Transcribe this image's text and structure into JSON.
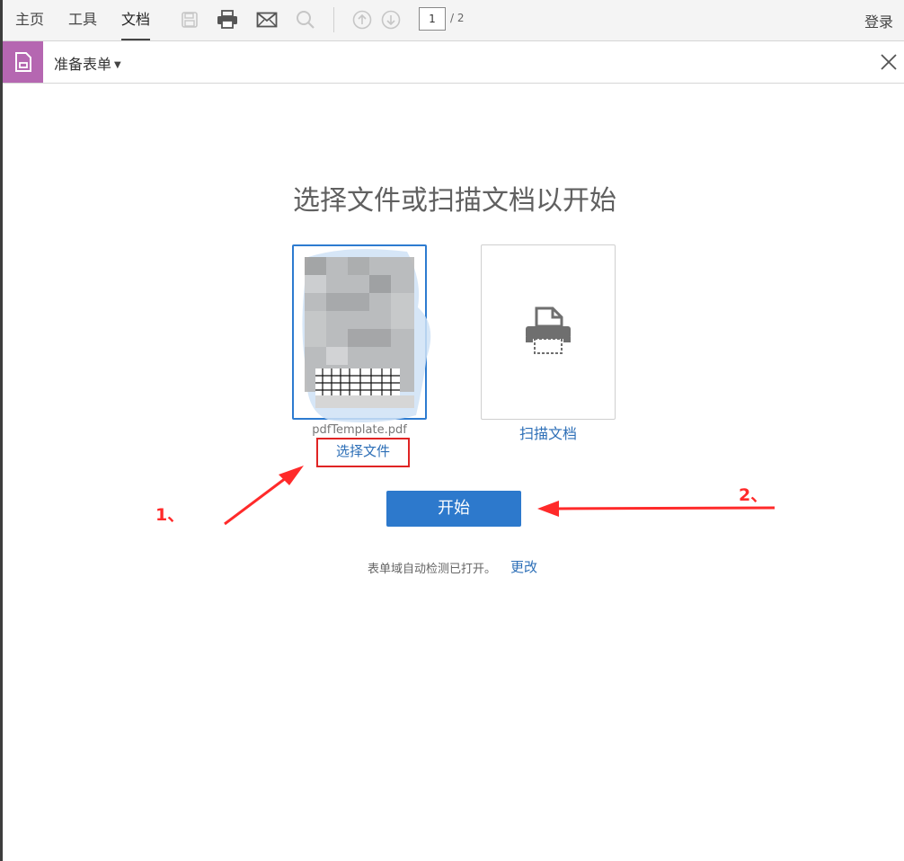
{
  "menubar": {
    "tabs": [
      {
        "label": "主页"
      },
      {
        "label": "工具"
      },
      {
        "label": "文档",
        "active": true
      }
    ],
    "icons": [
      "save-icon",
      "print-icon",
      "email-icon",
      "search-icon",
      "page-up-icon",
      "page-down-icon"
    ],
    "page_current": "1",
    "page_total": "/ 2",
    "login_label": "登录"
  },
  "toolbar": {
    "tool_name": "准备表单",
    "tool_icon": "form-document-icon",
    "accent_color": "#b567b1"
  },
  "main": {
    "heading": "选择文件或扫描文档以开始",
    "file_card": {
      "file_name": "pdfTemplate.pdf",
      "choose_label": "选择文件"
    },
    "scan_card": {
      "icon": "scanner-icon",
      "label": "扫描文档"
    },
    "start_label": "开始",
    "status_text": "表单域自动检测已打开。",
    "change_label": "更改",
    "primary_color": "#2d79cc"
  },
  "annotations": {
    "step1": "1、",
    "step2": "2、",
    "color": "#ff2a2a"
  }
}
